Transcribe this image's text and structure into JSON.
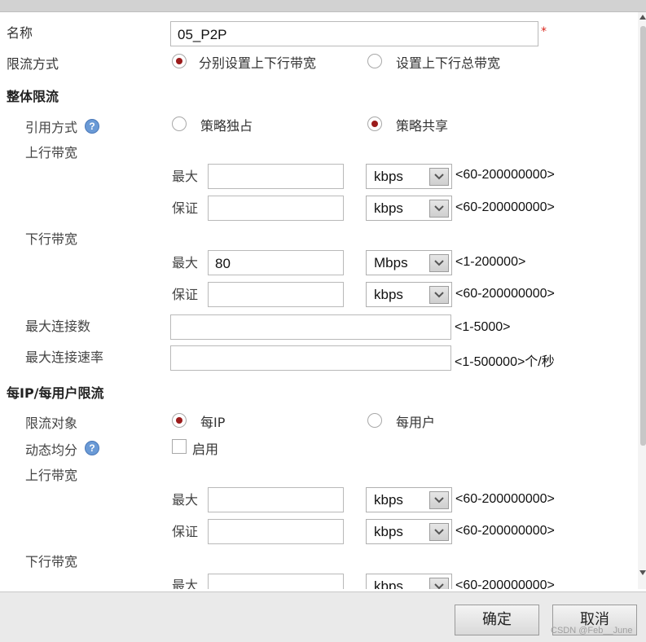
{
  "form": {
    "name": {
      "label": "名称",
      "value": "05_P2P",
      "required_mark": "*"
    },
    "limit_mode": {
      "label": "限流方式",
      "options": [
        "分别设置上下行带宽",
        "设置上下行总带宽"
      ],
      "selected": 0
    },
    "overall": {
      "title": "整体限流",
      "reference_mode": {
        "label": "引用方式",
        "options": [
          "策略独占",
          "策略共享"
        ],
        "selected": 1
      },
      "uplink": {
        "label": "上行带宽",
        "max": {
          "label": "最大",
          "value": "",
          "unit": "kbps",
          "range": "<60-200000000>"
        },
        "guarantee": {
          "label": "保证",
          "value": "",
          "unit": "kbps",
          "range": "<60-200000000>"
        }
      },
      "downlink": {
        "label": "下行带宽",
        "max": {
          "label": "最大",
          "value": "80",
          "unit": "Mbps",
          "range": "<1-200000>"
        },
        "guarantee": {
          "label": "保证",
          "value": "",
          "unit": "kbps",
          "range": "<60-200000000>"
        }
      },
      "max_connections": {
        "label": "最大连接数",
        "value": "",
        "range": "<1-5000>"
      },
      "max_conn_rate": {
        "label": "最大连接速率",
        "value": "",
        "range": "<1-500000>个/秒"
      }
    },
    "per_ip": {
      "title": "每IP/每用户限流",
      "target": {
        "label": "限流对象",
        "options": [
          "每IP",
          "每用户"
        ],
        "selected": 0
      },
      "dynamic": {
        "label": "动态均分",
        "checkbox_label": "启用",
        "checked": false
      },
      "uplink": {
        "label": "上行带宽",
        "max": {
          "label": "最大",
          "value": "",
          "unit": "kbps",
          "range": "<60-200000000>"
        },
        "guarantee": {
          "label": "保证",
          "value": "",
          "unit": "kbps",
          "range": "<60-200000000>"
        }
      },
      "downlink": {
        "label": "下行带宽",
        "max": {
          "label": "最大",
          "value": "",
          "unit": "kbps",
          "range": "<60-200000000>"
        }
      }
    }
  },
  "help_glyph": "?",
  "icons": {
    "help": "question-icon",
    "dropdown": "chevron-down-icon"
  },
  "footer": {
    "ok_label": "确定",
    "cancel_label": "取消",
    "watermark": "CSDN @Feb__June"
  }
}
